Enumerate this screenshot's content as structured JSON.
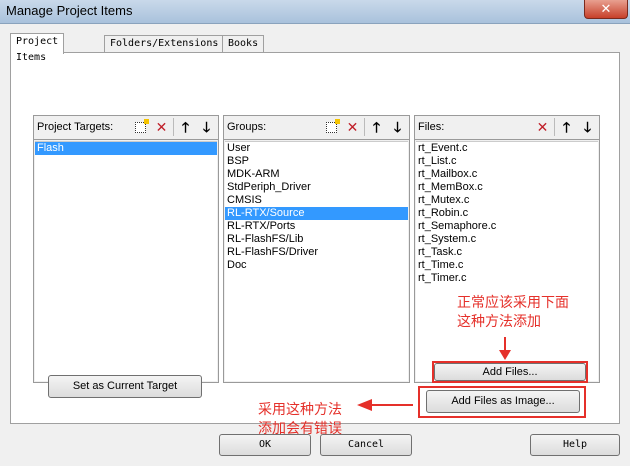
{
  "window": {
    "title": "Manage Project Items",
    "close_label": "✕"
  },
  "tabs": [
    {
      "label": "Project Items"
    },
    {
      "label": "Folders/Extensions"
    },
    {
      "label": "Books"
    }
  ],
  "targets": {
    "label": "Project Targets:",
    "items": [
      "Flash"
    ]
  },
  "groups": {
    "label": "Groups:",
    "items": [
      "User",
      "BSP",
      "MDK-ARM",
      "StdPeriph_Driver",
      "CMSIS",
      "RL-RTX/Source",
      "RL-RTX/Ports",
      "RL-FlashFS/Lib",
      "RL-FlashFS/Driver",
      "Doc"
    ]
  },
  "files": {
    "label": "Files:",
    "items": [
      "rt_Event.c",
      "rt_List.c",
      "rt_Mailbox.c",
      "rt_MemBox.c",
      "rt_Mutex.c",
      "rt_Robin.c",
      "rt_Semaphore.c",
      "rt_System.c",
      "rt_Task.c",
      "rt_Time.c",
      "rt_Timer.c"
    ]
  },
  "icons": {
    "new": "new-item-icon",
    "delete": "delete-icon",
    "up": "move-up-icon",
    "down": "move-down-icon"
  },
  "buttons": {
    "set_target": "Set as Current Target",
    "add_files": "Add Files...",
    "add_image": "Add Files as Image...",
    "ok": "OK",
    "cancel": "Cancel",
    "help": "Help"
  },
  "annotations": {
    "correct_line1": "正常应该采用下面",
    "correct_line2": "这种方法添加",
    "wrong_line1": "采用这种方法",
    "wrong_line2": "添加会有错误"
  },
  "colors": {
    "selection": "#3399ff",
    "annotation": "#e5302a"
  }
}
